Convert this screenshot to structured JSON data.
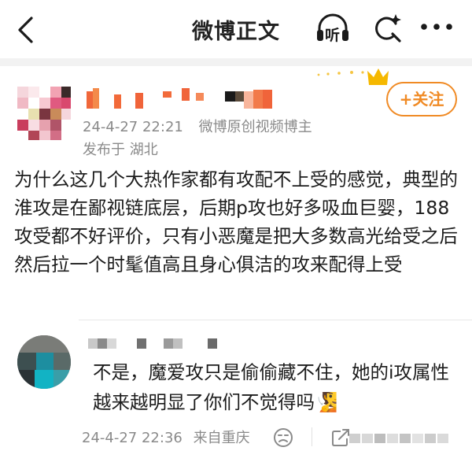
{
  "nav": {
    "title": "微博正文",
    "listen_label": "听"
  },
  "post": {
    "time": "24-4-27 22:21",
    "source": "微博原创视频博主",
    "location": "发布于 湖北",
    "follow_label": "+关注",
    "text": "为什么这几个大热作家都有攻配不上受的感觉，典型的淮攻是在鄙视链底层，后期p攻也好多吸血巨婴，188攻受都不好评价，只有小恶魔是把大多数高光给受之后然后拉一个时髦值高且身心俱洁的攻来配得上受"
  },
  "comment": {
    "text": "不是，魔爱攻只是偷偷藏不住，她的i攻属性越来越明显了你们不觉得吗",
    "emoji": "🧏",
    "time": "24-4-27 22:36",
    "location": "来自重庆"
  },
  "colors": {
    "accent": "#f08a24",
    "meta_gray": "#8a8a8a",
    "crown": "#f5b800"
  },
  "icons": [
    "back-arrow-icon",
    "headphones-icon",
    "search-sparkle-icon",
    "more-dots-icon",
    "crown-icon",
    "react-emoji-icon",
    "share-icon"
  ]
}
